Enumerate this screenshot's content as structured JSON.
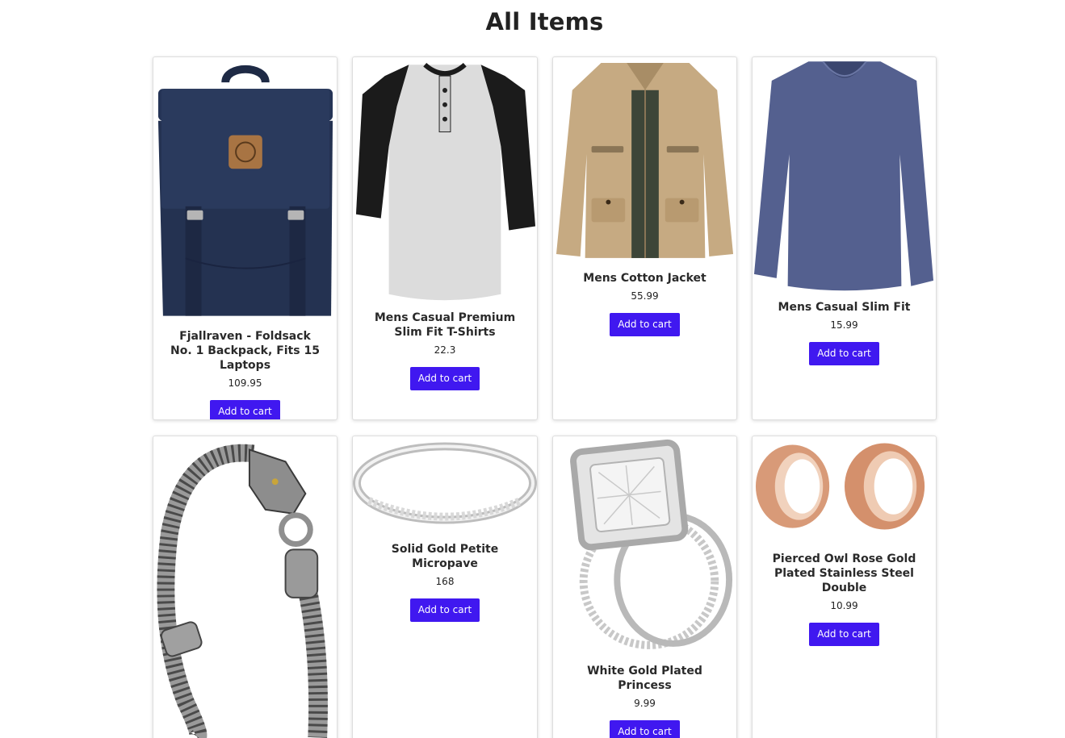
{
  "page": {
    "title": "All Items"
  },
  "accent_color": "#4018f0",
  "products": [
    {
      "name": "Fjallraven - Foldsack No. 1 Backpack, Fits 15 Laptops",
      "price": "109.95",
      "button": "Add to cart",
      "image": "navy-backpack"
    },
    {
      "name": "Mens Casual Premium Slim Fit T-Shirts",
      "price": "22.3",
      "button": "Add to cart",
      "image": "raglan-henley-shirt"
    },
    {
      "name": "Mens Cotton Jacket",
      "price": "55.99",
      "button": "Add to cart",
      "image": "khaki-cotton-jacket"
    },
    {
      "name": "Mens Casual Slim Fit",
      "price": "15.99",
      "button": "Add to cart",
      "image": "blue-long-sleeve-shirt"
    },
    {
      "name": "",
      "price": "",
      "button": "",
      "image": "silver-dragon-bracelet"
    },
    {
      "name": "Solid Gold Petite Micropave",
      "price": "168",
      "button": "Add to cart",
      "image": "micropave-ring"
    },
    {
      "name": "White Gold Plated Princess",
      "price": "9.99",
      "button": "Add to cart",
      "image": "princess-cut-ring-set"
    },
    {
      "name": "Pierced Owl Rose Gold Plated Stainless Steel Double",
      "price": "10.99",
      "button": "Add to cart",
      "image": "rose-gold-ear-tunnels"
    }
  ]
}
